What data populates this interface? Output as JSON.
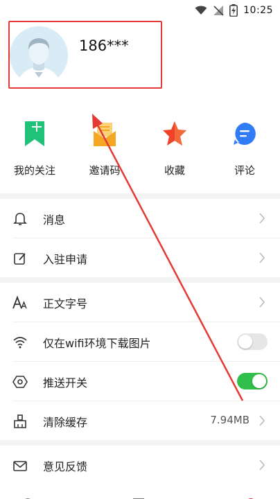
{
  "status": {
    "time": "10:25"
  },
  "profile": {
    "username": "186***"
  },
  "actions": [
    {
      "label": "我的关注",
      "icon": "bookmark-plus-icon",
      "color": "#20c27a"
    },
    {
      "label": "邀请码",
      "icon": "envelope-icon",
      "color": "#f5a623"
    },
    {
      "label": "收藏",
      "icon": "star-icon",
      "color": "#f0412a"
    },
    {
      "label": "评论",
      "icon": "chat-bubble-icon",
      "color": "#2f7cf6"
    }
  ],
  "menu": {
    "messages": {
      "label": "消息",
      "icon": "bell-icon"
    },
    "apply": {
      "label": "入驻申请",
      "icon": "edit-icon"
    },
    "font_size": {
      "label": "正文字号",
      "icon": "font-size-icon"
    },
    "wifi_images": {
      "label": "仅在wifi环境下载图片",
      "icon": "wifi-icon",
      "toggle": "off"
    },
    "push": {
      "label": "推送开关",
      "icon": "hexagon-icon",
      "toggle": "on"
    },
    "cache": {
      "label": "清除缓存",
      "icon": "broom-icon",
      "value": "7.94MB"
    },
    "feedback": {
      "label": "意见反馈",
      "icon": "mail-icon"
    }
  },
  "colors": {
    "toggle_on": "#2fbf4a",
    "annotation": "#e53935"
  }
}
